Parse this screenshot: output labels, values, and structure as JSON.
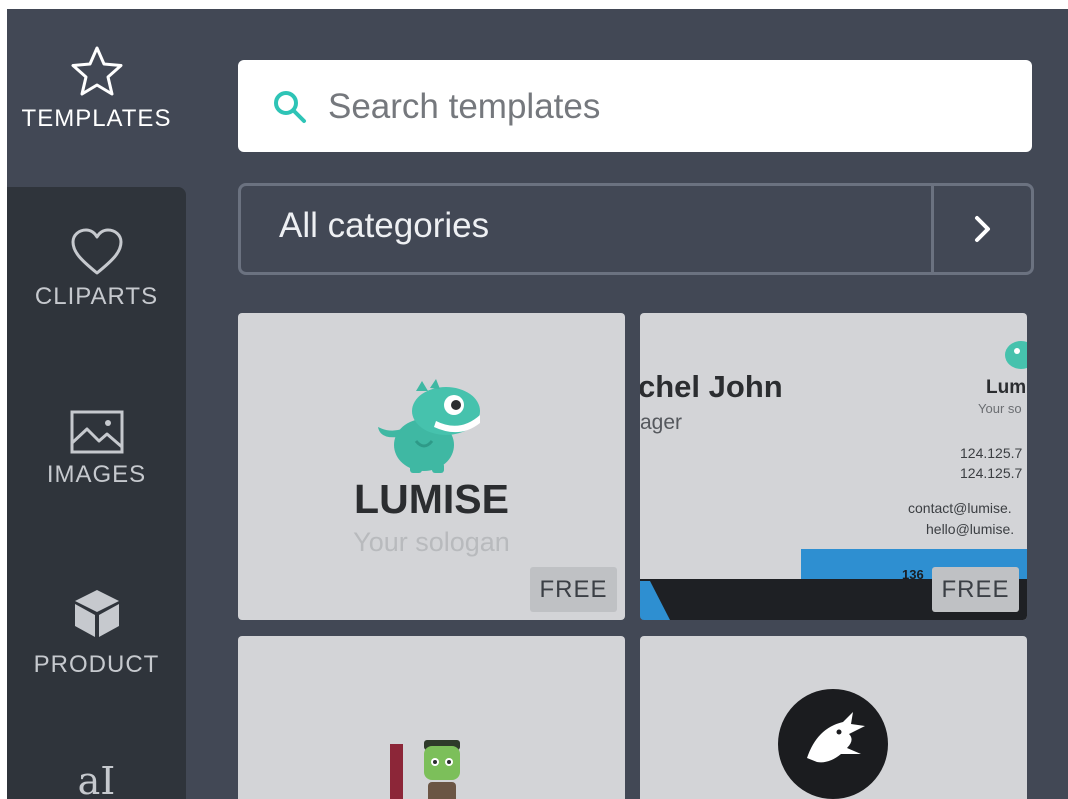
{
  "sidebar": {
    "items": [
      {
        "label": "TEMPLATES",
        "icon": "star-icon",
        "active": true
      },
      {
        "label": "CLIPARTS",
        "icon": "heart-icon"
      },
      {
        "label": "IMAGES",
        "icon": "image-icon"
      },
      {
        "label": "PRODUCT",
        "icon": "cube-icon"
      },
      {
        "label": "",
        "icon": "text-icon",
        "glyph": "aI"
      }
    ]
  },
  "search": {
    "placeholder": "Search templates",
    "icon": "search-icon"
  },
  "category": {
    "label": "All categories",
    "icon": "chevron-right-icon"
  },
  "templates": [
    {
      "title": "LUMISE",
      "subtitle": "Your sologan",
      "badge": "FREE",
      "mascot": "dinosaur-mascot"
    },
    {
      "name": "chel John",
      "role": "ager",
      "brand": "Lum",
      "brand_sub": "Your so",
      "phone1": "124.125.7",
      "phone2": "124.125.7",
      "email1": "contact@lumise.",
      "email2": "hello@lumise.",
      "address": "136",
      "badge": "FREE",
      "accent": "#2e8fd1"
    },
    {
      "mascot": "frankenstein-mascot"
    },
    {
      "mascot": "dragon-logo"
    }
  ],
  "colors": {
    "panel": "#424855",
    "sidebar": "#2f343b",
    "accent_teal": "#2ec4b6",
    "card": "#d3d4d7"
  }
}
